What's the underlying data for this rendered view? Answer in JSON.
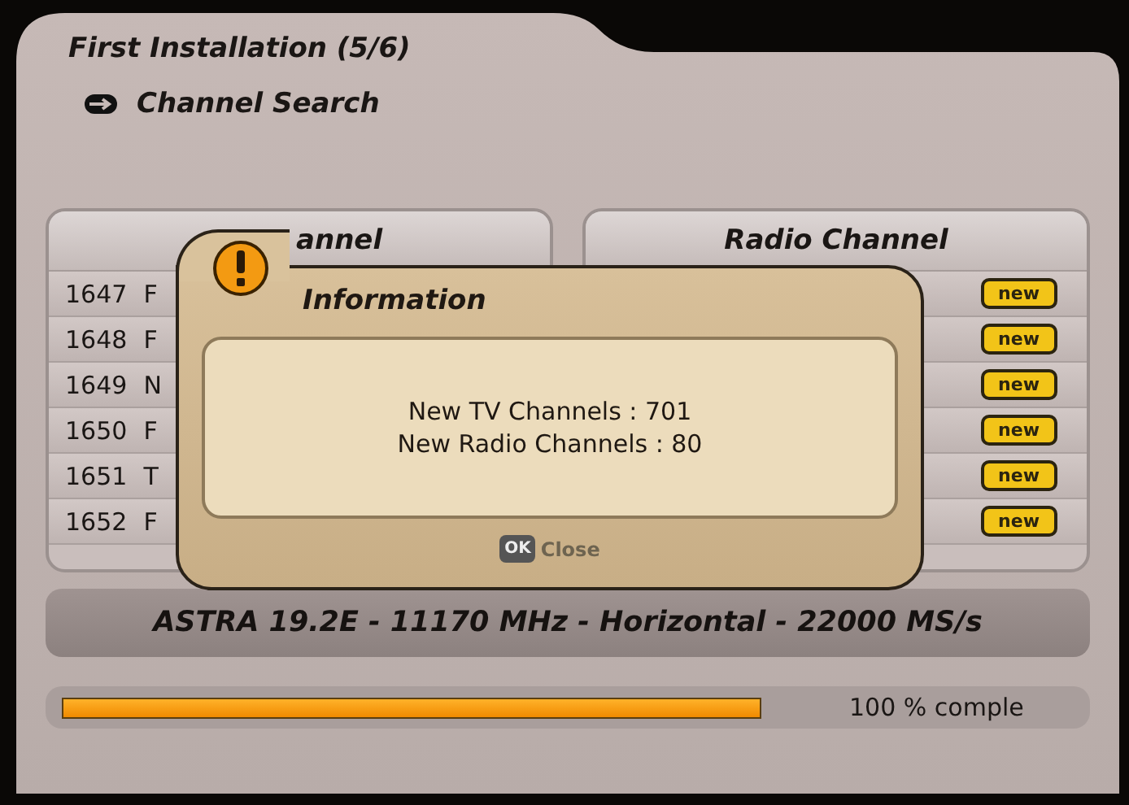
{
  "screen": {
    "title": "First Installation (5/6)",
    "subtitle": "Channel Search"
  },
  "tv_list": {
    "header": "annel",
    "rows": [
      {
        "number": "1647",
        "name": "F"
      },
      {
        "number": "1648",
        "name": "F"
      },
      {
        "number": "1649",
        "name": "N"
      },
      {
        "number": "1650",
        "name": "F"
      },
      {
        "number": "1651",
        "name": "T"
      },
      {
        "number": "1652",
        "name": "F"
      }
    ]
  },
  "radio_list": {
    "header": "Radio Channel",
    "rows": [
      {
        "badge": "new"
      },
      {
        "badge": "new"
      },
      {
        "badge": "new"
      },
      {
        "badge": "new"
      },
      {
        "badge": "new"
      },
      {
        "badge": "new"
      }
    ]
  },
  "dialog": {
    "title": "Information",
    "lines": [
      "New TV Channels : 701",
      "New Radio Channels : 80"
    ],
    "key": "OK",
    "button": "Close"
  },
  "transponder": "ASTRA 19.2E - 11170 MHz - Horizontal - 22000 MS/s",
  "progress": {
    "level": 1,
    "reading": "100 % comple"
  }
}
